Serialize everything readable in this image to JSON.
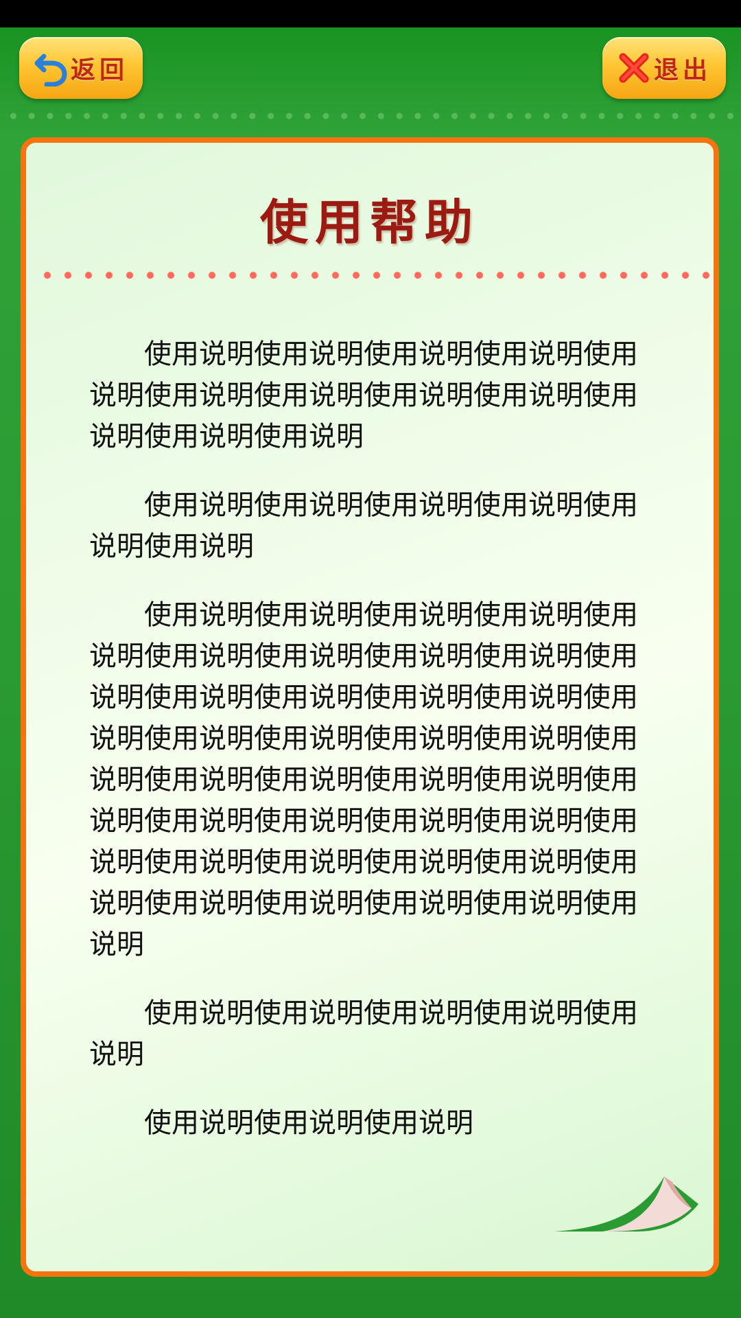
{
  "header": {
    "back_label": "返回",
    "exit_label": "退出",
    "back_icon": "undo-arrow-icon",
    "exit_icon": "close-x-icon"
  },
  "card": {
    "title": "使用帮助",
    "paragraphs": [
      "使用说明使用说明使用说明使用说明使用说明使用说明使用说明使用说明使用说明使用说明使用说明使用说明",
      "使用说明使用说明使用说明使用说明使用说明使用说明",
      "使用说明使用说明使用说明使用说明使用说明使用说明使用说明使用说明使用说明使用说明使用说明使用说明使用说明使用说明使用说明使用说明使用说明使用说明使用说明使用说明使用说明使用说明使用说明使用说明使用说明使用说明使用说明使用说明使用说明使用说明使用说明使用说明使用说明使用说明使用说明使用说明使用说明使用说明使用说明使用说明",
      "使用说明使用说明使用说明使用说明使用说明",
      "使用说明使用说明使用说明"
    ]
  },
  "colors": {
    "background_green": "#2a9a32",
    "card_border_orange": "#f6740f",
    "title_red": "#9b1a12",
    "button_label_red": "#c0280d",
    "divider_dot_red": "#ff6a5d"
  }
}
